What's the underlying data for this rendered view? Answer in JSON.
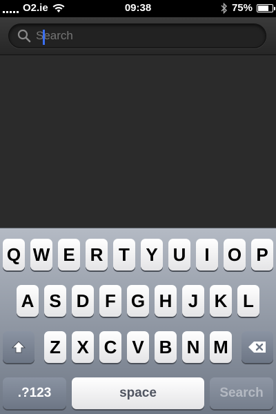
{
  "status_bar": {
    "carrier": "O2.ie",
    "time": "09:38",
    "battery_percent": "75%",
    "battery_level": 0.75,
    "icons": [
      "signal-icon",
      "wifi-icon",
      "bluetooth-icon",
      "battery-icon"
    ]
  },
  "search": {
    "placeholder": "Search",
    "value": "",
    "icon": "search-icon"
  },
  "keyboard": {
    "row1": [
      "Q",
      "W",
      "E",
      "R",
      "T",
      "Y",
      "U",
      "I",
      "O",
      "P"
    ],
    "row2": [
      "A",
      "S",
      "D",
      "F",
      "G",
      "H",
      "J",
      "K",
      "L"
    ],
    "row3": [
      "Z",
      "X",
      "C",
      "V",
      "B",
      "N",
      "M"
    ],
    "shift_icon": "shift-icon",
    "delete_icon": "delete-icon",
    "numbers_label": ".?123",
    "space_label": "space",
    "search_label": "Search"
  },
  "colors": {
    "caret": "#3a6ff2",
    "keyboard_top": "#b4bac4",
    "keyboard_bottom": "#6e7785"
  }
}
